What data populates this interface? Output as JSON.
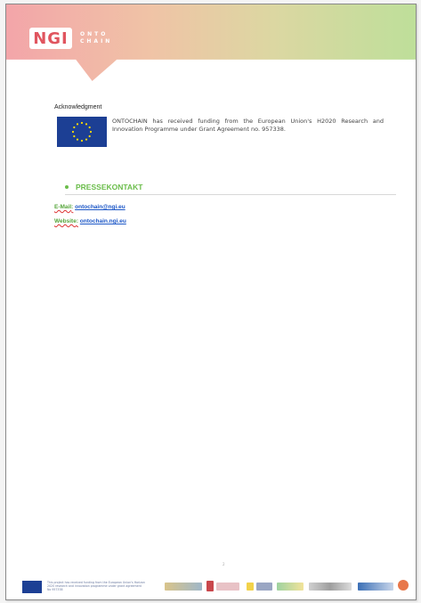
{
  "header": {
    "logo_mark": "NGI",
    "logo_word_1": "ONTO",
    "logo_word_2": "CHAIN"
  },
  "acknowledgment": {
    "title": "Acknowledgment",
    "text": "ONTOCHAIN has received funding from the European Union's H2020 Research and Innovation Programme under Grant Agreement no. 957338."
  },
  "press": {
    "heading": "PRESSEKONTAKT",
    "email_label": "E-Mail",
    "email_value": "ontochain@ngi.eu",
    "website_label": "Website",
    "website_value": "ontochain.ngi.eu"
  },
  "page_number": "2",
  "footer": {
    "funding_text": "This project has received funding from the European Union's Horizon 2020 research and innovation programme under grant agreement No 957338"
  },
  "colors": {
    "accent_green": "#6bbd4b",
    "link_blue": "#1c57c7",
    "eu_blue": "#1c3f94",
    "eu_star": "#ffdd00"
  }
}
